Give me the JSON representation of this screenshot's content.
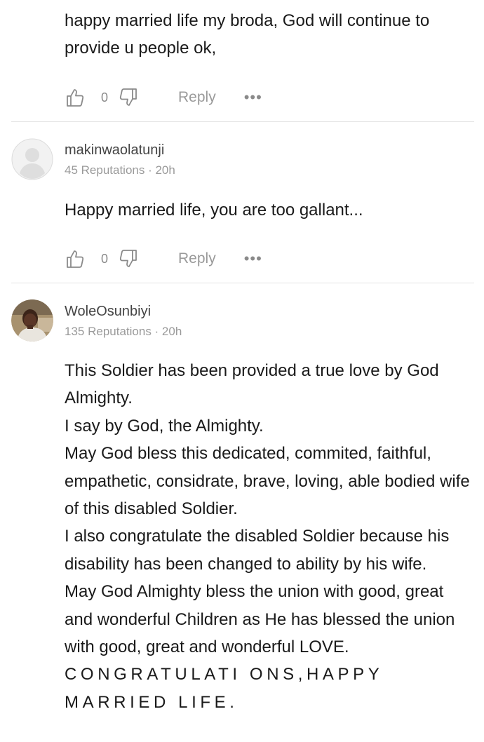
{
  "comments": [
    {
      "body": [
        "happy married life my broda, God will continue to provide u people ok,"
      ],
      "likes": "0",
      "reply_label": "Reply",
      "more_label": "•••"
    },
    {
      "username": "makinwaolatunji",
      "reputation": "45 Reputations",
      "time": "20h",
      "meta": "45 Reputations · 20h",
      "body": [
        "Happy married life, you are too gallant..."
      ],
      "likes": "0",
      "reply_label": "Reply",
      "more_label": "•••"
    },
    {
      "username": "WoleOsunbiyi",
      "reputation": "135 Reputations",
      "time": "20h",
      "meta": "135 Reputations · 20h",
      "body": [
        "This Soldier has been provided a true love by God Almighty.",
        "I say by God, the Almighty.",
        "May God bless this dedicated, commited, faithful, empathetic, considrate, brave, loving, able bodied wife of this disabled Soldier.",
        "I also congratulate the disabled Soldier because his disability has been changed to ability by his wife.",
        "May God Almighty bless the union with good, great and wonderful Children as He has blessed the union with good, great and wonderful LOVE.",
        "CONGRATULATI ONS,HAPPY MARRIED LIFE."
      ]
    }
  ],
  "icons": {
    "like": "thumbs-up-icon",
    "dislike": "thumbs-down-icon",
    "more": "more-options-icon",
    "avatar_default": "default-avatar-icon"
  },
  "colors": {
    "text": "#1a1a1a",
    "muted": "#9a9a9a",
    "divider": "#e4e4e4"
  }
}
